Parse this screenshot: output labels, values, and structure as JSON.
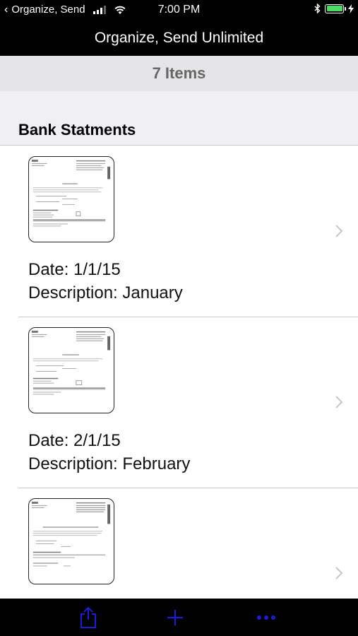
{
  "status_bar": {
    "back_app": "Organize, Send",
    "time": "7:00 PM"
  },
  "nav": {
    "title": "Organize, Send Unlimited"
  },
  "count": {
    "text": "7 Items"
  },
  "section": {
    "title": "Bank Statments"
  },
  "items": [
    {
      "date": "Date: 1/1/15",
      "description": "Description: January"
    },
    {
      "date": "Date: 2/1/15",
      "description": "Description: February"
    },
    {
      "date": "",
      "description": ""
    }
  ],
  "toolbar": {
    "icons": [
      "share-icon",
      "add-icon",
      "more-icon"
    ],
    "icon_color": "#1c1cd6"
  },
  "colors": {
    "bar_background": "#000000",
    "count_background": "#e5e5e8",
    "battery": "#4cd964"
  }
}
